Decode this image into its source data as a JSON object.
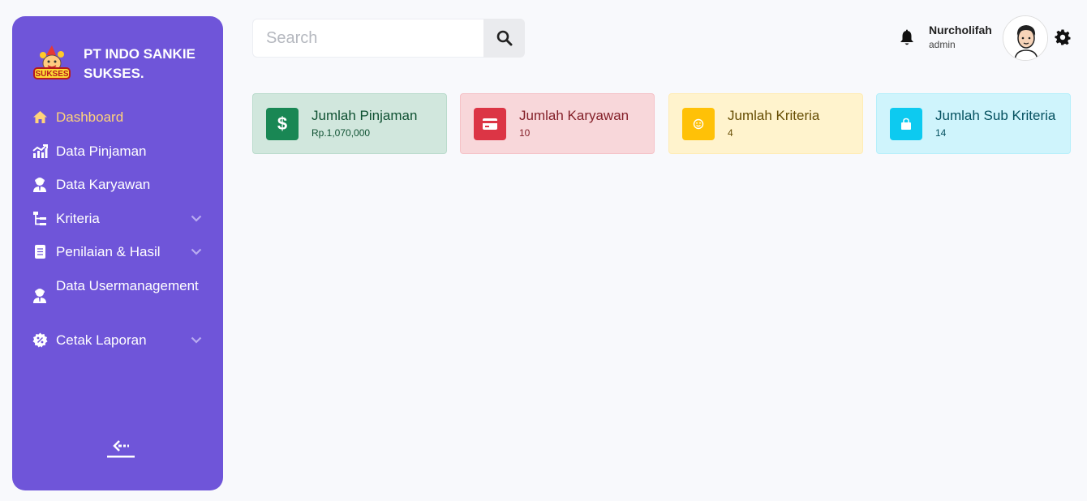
{
  "brand": {
    "name": "PT INDO SANKIE SUKSES."
  },
  "sidebar": {
    "items": [
      {
        "label": "Dashboard",
        "icon": "home-icon",
        "active": true,
        "has_submenu": false
      },
      {
        "label": "Data Pinjaman",
        "icon": "chart-icon",
        "active": false,
        "has_submenu": false
      },
      {
        "label": "Data Karyawan",
        "icon": "user-tie-icon",
        "active": false,
        "has_submenu": false
      },
      {
        "label": "Kriteria",
        "icon": "sitemap-icon",
        "active": false,
        "has_submenu": true
      },
      {
        "label": "Penilaian & Hasil",
        "icon": "document-icon",
        "active": false,
        "has_submenu": true
      },
      {
        "label": "Data Usermanagement",
        "icon": "user-tie-icon",
        "active": false,
        "has_submenu": false
      },
      {
        "label": "Cetak Laporan",
        "icon": "badge-percent-icon",
        "active": false,
        "has_submenu": true
      }
    ],
    "active_color": "#ffd37a",
    "background": "#6f55d9"
  },
  "search": {
    "placeholder": "Search",
    "value": ""
  },
  "user": {
    "name": "Nurcholifah",
    "role": "admin"
  },
  "cards": [
    {
      "title": "Jumlah Pinjaman",
      "value": "Rp.1,070,000",
      "icon": "dollar-icon",
      "color": "#198754"
    },
    {
      "title": "Jumlah Karyawan",
      "value": "10",
      "icon": "credit-card-icon",
      "color": "#dc3545"
    },
    {
      "title": "Jumlah Kriteria",
      "value": "4",
      "icon": "smile-icon",
      "color": "#ffc107"
    },
    {
      "title": "Jumlah Sub Kriteria",
      "value": "14",
      "icon": "shopping-bag-icon",
      "color": "#0dcaf0"
    }
  ]
}
